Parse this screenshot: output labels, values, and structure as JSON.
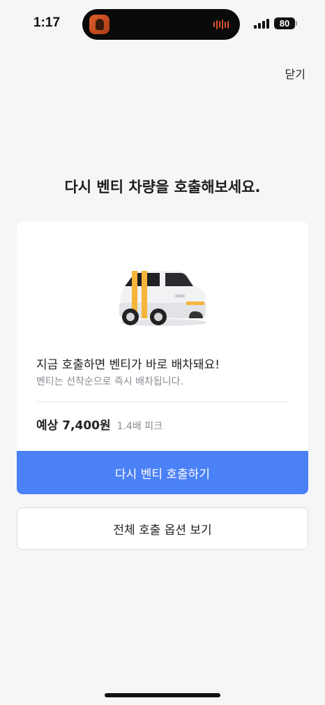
{
  "status_bar": {
    "time": "1:17",
    "battery": "80",
    "live_activity_icon": "podcast-app-icon",
    "waveform_icon": "audio-waveform-icon",
    "accent_color": "#d8532a"
  },
  "header": {
    "close_label": "닫기"
  },
  "headline": "다시 벤티 차량을 호출해보세요.",
  "card": {
    "car_icon": "venti-taxi-icon",
    "title": "지금 호출하면 벤티가 바로 배차돼요!",
    "subtitle": "벤티는 선착순으로 즉시 배차됩니다.",
    "price": "예상 7,400원",
    "surge": "1.4배 피크",
    "primary_button_label": "다시 벤티 호출하기",
    "primary_color": "#4b81f6"
  },
  "secondary_button_label": "전체 호출 옵션 보기"
}
